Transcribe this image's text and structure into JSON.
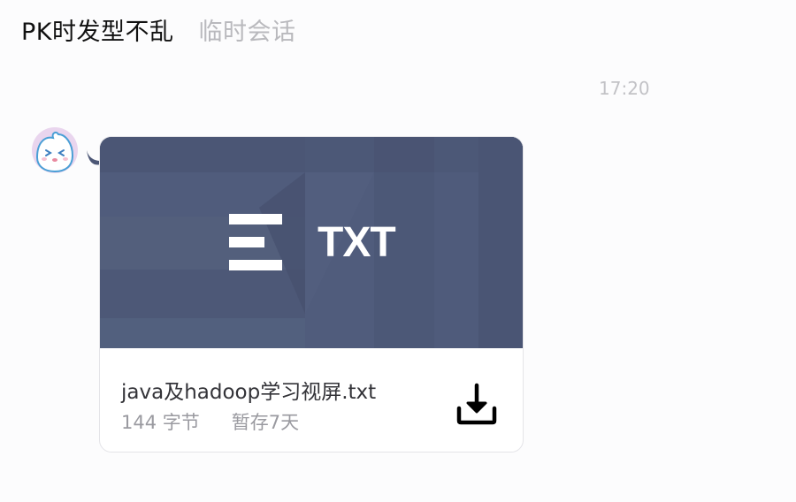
{
  "header": {
    "contact_name": "PK时发型不乱",
    "chat_type": "临时会话"
  },
  "messages": [
    {
      "timestamp": "17:20",
      "sender_avatar": "avatar-emoji-icon",
      "file": {
        "extension": "TXT",
        "name": "java及hadoop学习视屏.txt",
        "size": "144 字节",
        "retention": "暂存7天",
        "icon": "text-file-icon",
        "action_icon": "download-icon"
      }
    }
  ],
  "colors": {
    "preview_bg": "#4c5776",
    "name_text": "#333338",
    "meta_text": "#9a9aa0",
    "timestamp_text": "#c2c2c6"
  }
}
